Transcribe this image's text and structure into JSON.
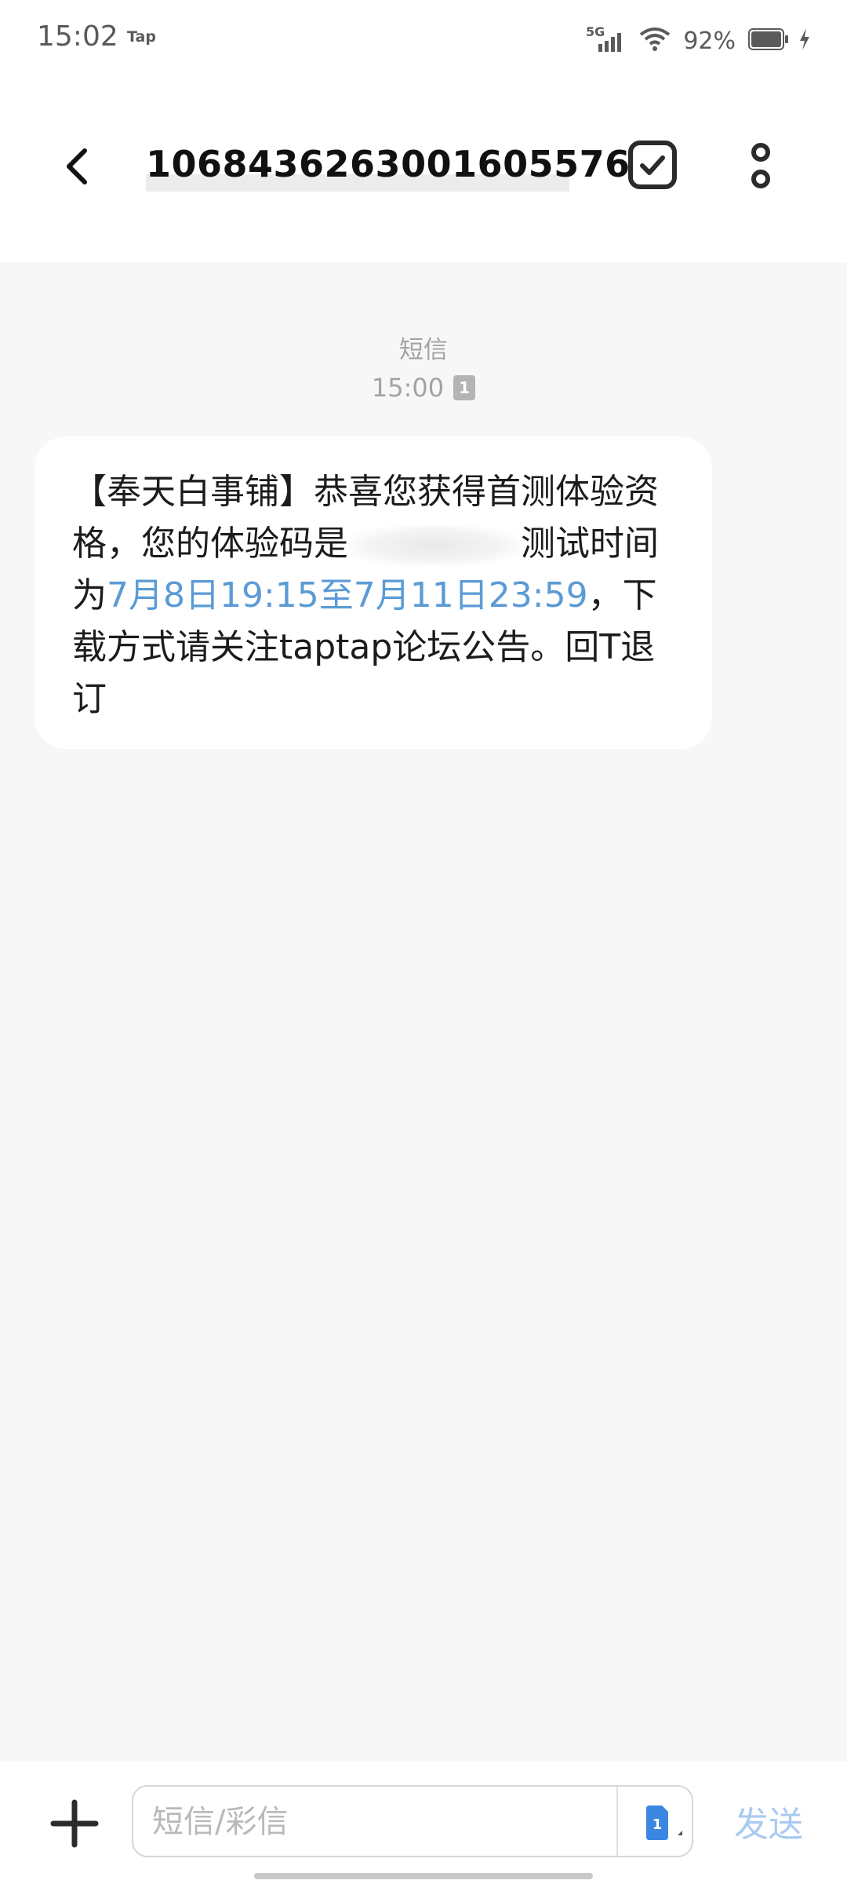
{
  "status_bar": {
    "time": "15:02",
    "app_indicator": "Tap",
    "network": "5G",
    "battery_percent": "92%",
    "battery_level": 0.92,
    "charging": true
  },
  "header": {
    "title": "1068436263001605576",
    "icons": [
      "back-arrow-icon",
      "checkbox-select-icon",
      "more-vertical-icon"
    ]
  },
  "conversation": {
    "type_label": "短信",
    "time": "15:00",
    "sim_badge": "1",
    "message": {
      "part1": "【奉天白事铺】恭喜您获得首测体验资格，您的体验码是",
      "part2": "测试时间为",
      "date_link": "7月8日19:15至7月11日23:59",
      "part3": "，下载方式请关注taptap论坛公告。回T退订"
    }
  },
  "composer": {
    "placeholder": "短信/彩信",
    "sim_label": "1",
    "send_label": "发送"
  },
  "colors": {
    "link": "#5b9bd5",
    "send_disabled": "#a9cbf0",
    "sim_blue": "#3a86e0",
    "background": "#f7f7f7"
  }
}
